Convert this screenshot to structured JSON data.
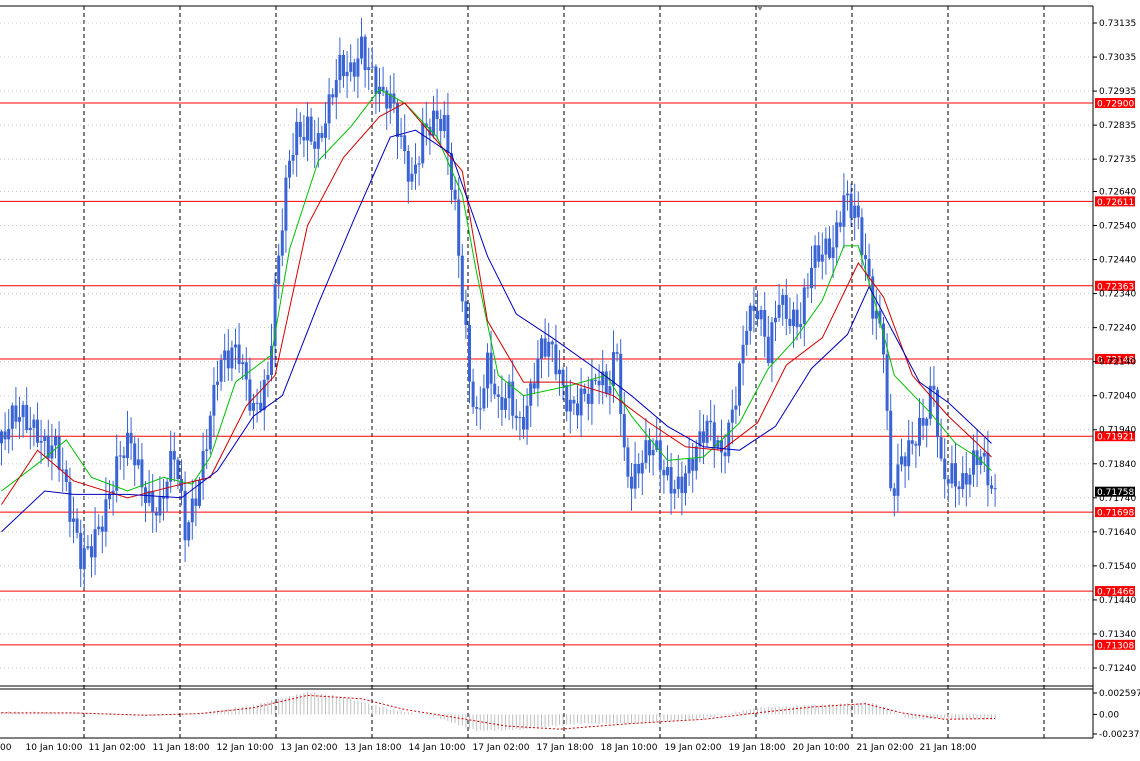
{
  "chart_data": [
    {
      "type": "candlestick",
      "title": "",
      "ylim": [
        0.7119,
        0.73185
      ],
      "y_ticks": [
        "0.73135",
        "0.73035",
        "0.72935",
        "0.72835",
        "0.72735",
        "0.72640",
        "0.72540",
        "0.72440",
        "0.72340",
        "0.72240",
        "0.72140",
        "0.72040",
        "0.71940",
        "0.71840",
        "0.71740",
        "0.71640",
        "0.71540",
        "0.71440",
        "0.71340",
        "0.71240"
      ],
      "x_labels": [
        "10 Jan 10:00",
        "11 Jan 02:00",
        "11 Jan 18:00",
        "12 Jan 10:00",
        "13 Jan 02:00",
        "13 Jan 18:00",
        "14 Jan 10:00",
        "17 Jan 02:00",
        "17 Jan 18:00",
        "18 Jan 10:00",
        "19 Jan 02:00",
        "19 Jan 18:00",
        "20 Jan 10:00",
        "21 Jan 02:00",
        "21 Jan 18:00"
      ],
      "x_partial_label": "00",
      "current_price": "0.71758",
      "current_price_color": "#000000",
      "level_color": "#ff0000",
      "candle_color": "#3a63d4",
      "levels": [
        {
          "value": 0.729,
          "label": "0.72900"
        },
        {
          "value": 0.72611,
          "label": "0.72611"
        },
        {
          "value": 0.72363,
          "label": "0.72363"
        },
        {
          "value": 0.72148,
          "label": "0.72148"
        },
        {
          "value": 0.71921,
          "label": "0.71921"
        },
        {
          "value": 0.71698,
          "label": "0.71698"
        },
        {
          "value": 0.71466,
          "label": "0.71466"
        },
        {
          "value": 0.71308,
          "label": "0.71308"
        }
      ],
      "close_path": [
        [
          0,
          0.719
        ],
        [
          5,
          0.7194
        ],
        [
          10,
          0.7198
        ],
        [
          15,
          0.7189
        ],
        [
          19,
          0.7165
        ],
        [
          22,
          0.7156
        ],
        [
          26,
          0.7168
        ],
        [
          30,
          0.7174
        ],
        [
          36,
          0.7188
        ],
        [
          40,
          0.718
        ],
        [
          44,
          0.7172
        ],
        [
          48,
          0.7182
        ],
        [
          51,
          0.7162
        ],
        [
          53,
          0.7173
        ],
        [
          57,
          0.7196
        ],
        [
          60,
          0.721
        ],
        [
          63,
          0.721
        ],
        [
          66,
          0.7215
        ],
        [
          70,
          0.7205
        ],
        [
          74,
          0.721
        ],
        [
          78,
          0.725
        ],
        [
          80,
          0.727
        ],
        [
          82,
          0.7282
        ],
        [
          85,
          0.7288
        ],
        [
          88,
          0.728
        ],
        [
          91,
          0.7285
        ],
        [
          94,
          0.7296
        ],
        [
          97,
          0.73
        ],
        [
          100,
          0.7312
        ],
        [
          103,
          0.73
        ],
        [
          106,
          0.7287
        ],
        [
          108,
          0.7286
        ],
        [
          111,
          0.7278
        ],
        [
          114,
          0.7272
        ],
        [
          117,
          0.7285
        ],
        [
          120,
          0.7282
        ],
        [
          123,
          0.7278
        ],
        [
          126,
          0.7258
        ],
        [
          128,
          0.7238
        ],
        [
          130,
          0.7215
        ],
        [
          132,
          0.72
        ],
        [
          135,
          0.721
        ],
        [
          138,
          0.7195
        ],
        [
          141,
          0.7205
        ],
        [
          144,
          0.72
        ],
        [
          147,
          0.7208
        ],
        [
          150,
          0.7215
        ],
        [
          153,
          0.7212
        ],
        [
          156,
          0.7206
        ],
        [
          158,
          0.7205
        ],
        [
          161,
          0.7208
        ],
        [
          164,
          0.7204
        ],
        [
          166,
          0.7205
        ],
        [
          168,
          0.72
        ],
        [
          171,
          0.7218
        ],
        [
          173,
          0.719
        ],
        [
          175,
          0.7184
        ],
        [
          178,
          0.7186
        ],
        [
          181,
          0.7184
        ],
        [
          184,
          0.7178
        ],
        [
          187,
          0.718
        ],
        [
          190,
          0.7186
        ],
        [
          193,
          0.7188
        ],
        [
          196,
          0.719
        ],
        [
          200,
          0.7185
        ],
        [
          204,
          0.721
        ],
        [
          207,
          0.7228
        ],
        [
          210,
          0.7225
        ],
        [
          213,
          0.7212
        ],
        [
          216,
          0.7235
        ],
        [
          219,
          0.7232
        ],
        [
          222,
          0.7228
        ],
        [
          225,
          0.7238
        ],
        [
          228,
          0.7242
        ],
        [
          231,
          0.725
        ],
        [
          234,
          0.7268
        ],
        [
          237,
          0.726
        ],
        [
          240,
          0.7238
        ],
        [
          242,
          0.7225
        ],
        [
          245,
          0.722
        ],
        [
          247,
          0.718
        ],
        [
          250,
          0.719
        ],
        [
          253,
          0.7188
        ],
        [
          256,
          0.719
        ],
        [
          259,
          0.7205
        ],
        [
          261,
          0.7185
        ],
        [
          264,
          0.7186
        ],
        [
          267,
          0.7178
        ],
        [
          269,
          0.7178
        ],
        [
          272,
          0.7182
        ],
        [
          275,
          0.7178
        ],
        [
          277,
          0.7176
        ]
      ],
      "series": [
        {
          "color": "#00c000",
          "points": [
            [
              0,
              0.7176
            ],
            [
              10,
              0.7184
            ],
            [
              18,
              0.7191
            ],
            [
              25,
              0.718
            ],
            [
              35,
              0.7176
            ],
            [
              45,
              0.718
            ],
            [
              53,
              0.7178
            ],
            [
              58,
              0.7186
            ],
            [
              65,
              0.7208
            ],
            [
              75,
              0.7216
            ],
            [
              80,
              0.7247
            ],
            [
              88,
              0.7273
            ],
            [
              97,
              0.7283
            ],
            [
              105,
              0.7294
            ],
            [
              112,
              0.729
            ],
            [
              121,
              0.728
            ],
            [
              128,
              0.7263
            ],
            [
              132,
              0.724
            ],
            [
              138,
              0.721
            ],
            [
              145,
              0.7204
            ],
            [
              158,
              0.7207
            ],
            [
              168,
              0.721
            ],
            [
              175,
              0.7198
            ],
            [
              185,
              0.7185
            ],
            [
              195,
              0.7186
            ],
            [
              205,
              0.7196
            ],
            [
              213,
              0.7212
            ],
            [
              220,
              0.722
            ],
            [
              228,
              0.7232
            ],
            [
              234,
              0.7248
            ],
            [
              238,
              0.7248
            ],
            [
              243,
              0.723
            ],
            [
              248,
              0.721
            ],
            [
              258,
              0.7199
            ],
            [
              265,
              0.719
            ],
            [
              271,
              0.7186
            ],
            [
              275,
              0.7182
            ]
          ]
        },
        {
          "color": "#d00000",
          "points": [
            [
              0,
              0.7172
            ],
            [
              10,
              0.7188
            ],
            [
              20,
              0.7179
            ],
            [
              35,
              0.7174
            ],
            [
              50,
              0.7178
            ],
            [
              58,
              0.718
            ],
            [
              68,
              0.7201
            ],
            [
              76,
              0.721
            ],
            [
              85,
              0.7254
            ],
            [
              95,
              0.7274
            ],
            [
              105,
              0.7286
            ],
            [
              112,
              0.729
            ],
            [
              120,
              0.728
            ],
            [
              128,
              0.727
            ],
            [
              135,
              0.7226
            ],
            [
              145,
              0.7208
            ],
            [
              158,
              0.7208
            ],
            [
              170,
              0.7204
            ],
            [
              180,
              0.7196
            ],
            [
              190,
              0.7189
            ],
            [
              200,
              0.7188
            ],
            [
              210,
              0.7196
            ],
            [
              218,
              0.7213
            ],
            [
              228,
              0.7221
            ],
            [
              238,
              0.7243
            ],
            [
              245,
              0.7233
            ],
            [
              253,
              0.721
            ],
            [
              263,
              0.7198
            ],
            [
              270,
              0.7191
            ],
            [
              275,
              0.7186
            ]
          ]
        },
        {
          "color": "#0000c0",
          "points": [
            [
              0,
              0.7164
            ],
            [
              12,
              0.7176
            ],
            [
              20,
              0.7175
            ],
            [
              35,
              0.7175
            ],
            [
              50,
              0.7174
            ],
            [
              60,
              0.7182
            ],
            [
              70,
              0.7198
            ],
            [
              78,
              0.7204
            ],
            [
              88,
              0.7231
            ],
            [
              98,
              0.7256
            ],
            [
              108,
              0.728
            ],
            [
              115,
              0.7282
            ],
            [
              125,
              0.7275
            ],
            [
              135,
              0.7245
            ],
            [
              143,
              0.7228
            ],
            [
              153,
              0.7221
            ],
            [
              165,
              0.7212
            ],
            [
              175,
              0.7204
            ],
            [
              185,
              0.7195
            ],
            [
              195,
              0.7189
            ],
            [
              205,
              0.7188
            ],
            [
              215,
              0.7195
            ],
            [
              225,
              0.7212
            ],
            [
              235,
              0.7222
            ],
            [
              241,
              0.7236
            ],
            [
              248,
              0.7222
            ],
            [
              255,
              0.7208
            ],
            [
              263,
              0.7202
            ],
            [
              270,
              0.7195
            ],
            [
              275,
              0.719
            ]
          ]
        }
      ]
    },
    {
      "type": "histogram",
      "ylim": [
        -0.002379,
        0.002597
      ],
      "y_ticks": [
        "0.002597",
        "0.00",
        "-0.002379"
      ],
      "bar_color": "#c0c0c0",
      "signal_color": "#d00000",
      "signal_points": [
        [
          0,
          0.0002
        ],
        [
          20,
          0.00018
        ],
        [
          40,
          -0.0001
        ],
        [
          55,
          0.0001
        ],
        [
          70,
          0.0008
        ],
        [
          85,
          0.0023
        ],
        [
          100,
          0.0019
        ],
        [
          112,
          0.0006
        ],
        [
          125,
          -0.0003
        ],
        [
          140,
          -0.0014
        ],
        [
          155,
          -0.0018
        ],
        [
          175,
          -0.0011
        ],
        [
          195,
          -0.0006
        ],
        [
          210,
          0.0002
        ],
        [
          225,
          0.0009
        ],
        [
          240,
          0.0013
        ],
        [
          250,
          0.0002
        ],
        [
          262,
          -0.0006
        ],
        [
          276,
          -0.0005
        ]
      ],
      "hist_points": [
        [
          0,
          0.0003
        ],
        [
          20,
          0.0002
        ],
        [
          40,
          -0.0002
        ],
        [
          55,
          0.0001
        ],
        [
          70,
          0.0011
        ],
        [
          85,
          0.0027
        ],
        [
          95,
          0.0021
        ],
        [
          108,
          0.0006
        ],
        [
          120,
          -0.0002
        ],
        [
          132,
          -0.002
        ],
        [
          145,
          -0.0018
        ],
        [
          160,
          -0.0011
        ],
        [
          175,
          -0.0011
        ],
        [
          195,
          -0.0005
        ],
        [
          210,
          0.0008
        ],
        [
          230,
          0.0012
        ],
        [
          242,
          0.0014
        ],
        [
          252,
          -0.0005
        ],
        [
          276,
          -0.0006
        ]
      ]
    }
  ]
}
